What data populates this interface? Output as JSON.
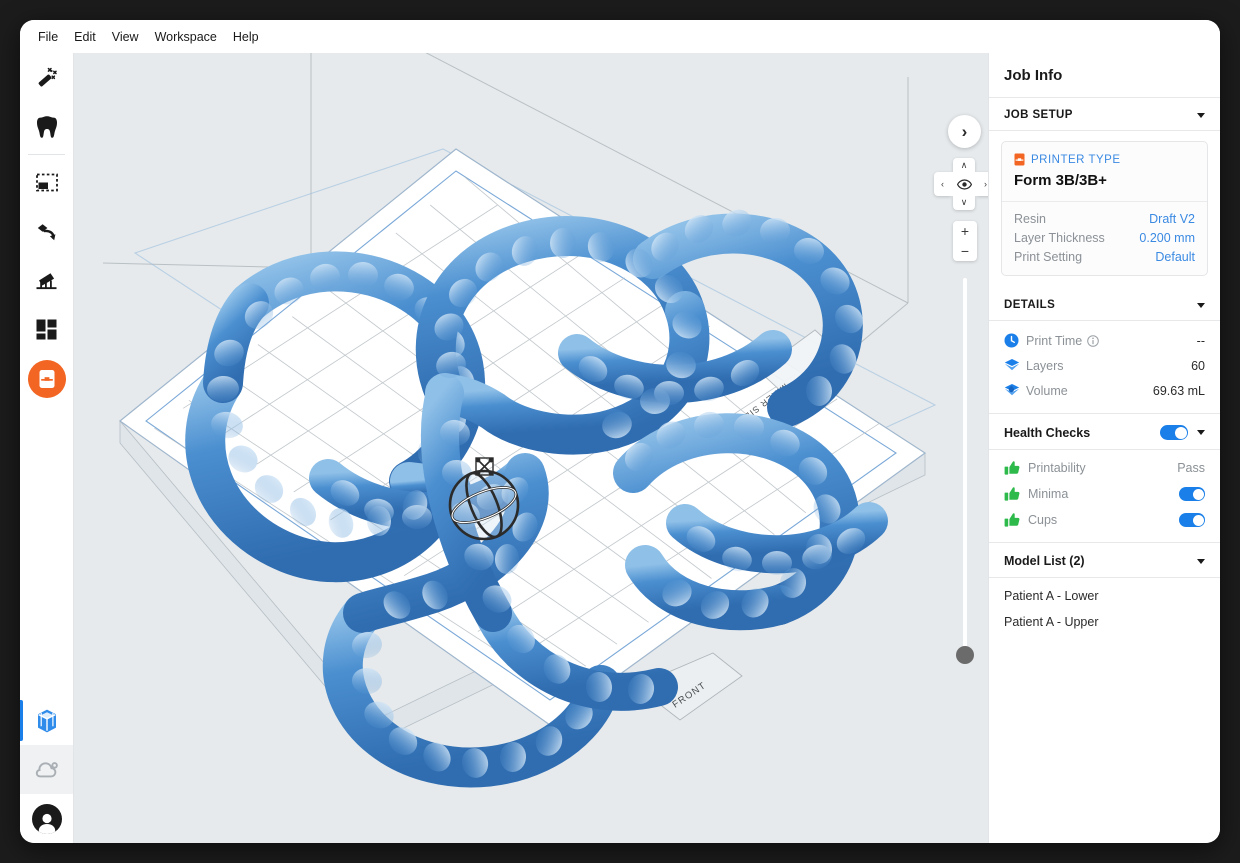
{
  "app": {
    "menu": [
      "File",
      "Edit",
      "View",
      "Workspace",
      "Help"
    ]
  },
  "toolbar": {
    "items": [
      {
        "name": "magic-wand-tool",
        "label": "One Click Print"
      },
      {
        "name": "tooth-tool",
        "label": "Dental"
      },
      {
        "name": "select-scale-tool",
        "label": "Size"
      },
      {
        "name": "orient-tool",
        "label": "Orient"
      },
      {
        "name": "supports-tool",
        "label": "Supports"
      },
      {
        "name": "layout-tool",
        "label": "Layout"
      },
      {
        "name": "print-tool",
        "label": "Print"
      }
    ],
    "bottom_items": [
      {
        "name": "build-volume-tool",
        "label": "Build Volume"
      },
      {
        "name": "cloud-tool",
        "label": "Dashboard"
      },
      {
        "name": "account-avatar",
        "label": "Account"
      }
    ]
  },
  "viewport": {
    "labels": {
      "mixer_side": "MIXER SIDE",
      "front": "FRONT"
    },
    "controls": {
      "collapse": "›",
      "up": "∧",
      "down": "∨",
      "left": "‹",
      "right": "›",
      "zoom_in": "+",
      "zoom_out": "−"
    },
    "colors": {
      "background": "#e6eaec",
      "model": "#3d7ec4",
      "plate_outline": "#7aa8d8"
    }
  },
  "panel": {
    "title": "Job Info",
    "job_setup": {
      "header": "JOB SETUP",
      "printer_type_label": "PRINTER TYPE",
      "printer_name": "Form 3B/3B+",
      "rows": [
        {
          "key": "Resin",
          "value": "Draft V2"
        },
        {
          "key": "Layer Thickness",
          "value": "0.200 mm"
        },
        {
          "key": "Print Setting",
          "value": "Default"
        }
      ]
    },
    "details": {
      "header": "DETAILS",
      "rows": [
        {
          "icon": "clock-icon",
          "name": "Print Time",
          "info": true,
          "value": "--"
        },
        {
          "icon": "layers-icon",
          "name": "Layers",
          "info": false,
          "value": "60"
        },
        {
          "icon": "volume-icon",
          "name": "Volume",
          "info": false,
          "value": "69.63 mL"
        }
      ]
    },
    "health_checks": {
      "header": "Health Checks",
      "master_toggle": true,
      "rows": [
        {
          "name": "Printability",
          "value": "Pass",
          "type": "text"
        },
        {
          "name": "Minima",
          "value": "",
          "type": "toggle",
          "on": true
        },
        {
          "name": "Cups",
          "value": "",
          "type": "toggle",
          "on": true
        }
      ]
    },
    "model_list": {
      "header": "Model List (2)",
      "items": [
        "Patient A - Lower",
        "Patient A - Upper"
      ]
    },
    "colors": {
      "accent_blue": "#3b8ae2",
      "toggle_blue": "#1a7fe8",
      "orange": "#f26522",
      "thumb_green": "#2eb94b"
    }
  }
}
